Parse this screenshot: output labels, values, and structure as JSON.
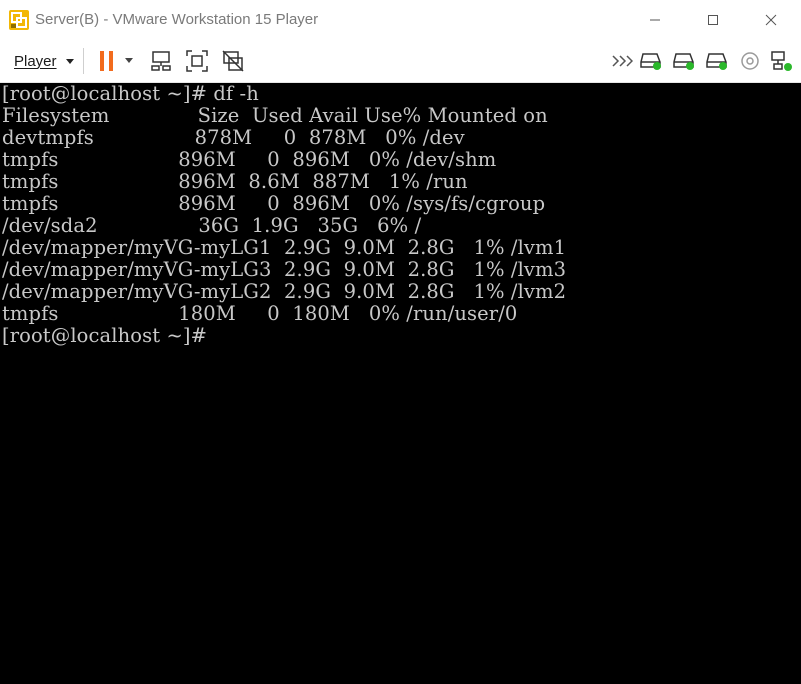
{
  "window": {
    "title": "Server(B) - VMware Workstation 15 Player"
  },
  "toolbar": {
    "player_label": "Player",
    "icons": [
      "pause-icon",
      "send-ctrl-alt-del-icon",
      "fit-guest-icon",
      "unity-icon",
      "more-devices-icon",
      "hdd-icon",
      "hdd-icon",
      "hdd-icon",
      "cd-icon",
      "network-icon"
    ]
  },
  "console": {
    "lines": [
      "[root@localhost ~]# df -h",
      "Filesystem              Size  Used Avail Use% Mounted on",
      "devtmpfs                878M     0  878M   0% /dev",
      "tmpfs                   896M     0  896M   0% /dev/shm",
      "tmpfs                   896M  8.6M  887M   1% /run",
      "tmpfs                   896M     0  896M   0% /sys/fs/cgroup",
      "/dev/sda2                36G  1.9G   35G   6% /",
      "/dev/mapper/myVG-myLG1  2.9G  9.0M  2.8G   1% /lvm1",
      "/dev/mapper/myVG-myLG3  2.9G  9.0M  2.8G   1% /lvm3",
      "/dev/mapper/myVG-myLG2  2.9G  9.0M  2.8G   1% /lvm2",
      "tmpfs                   180M     0  180M   0% /run/user/0",
      "[root@localhost ~]#"
    ]
  }
}
